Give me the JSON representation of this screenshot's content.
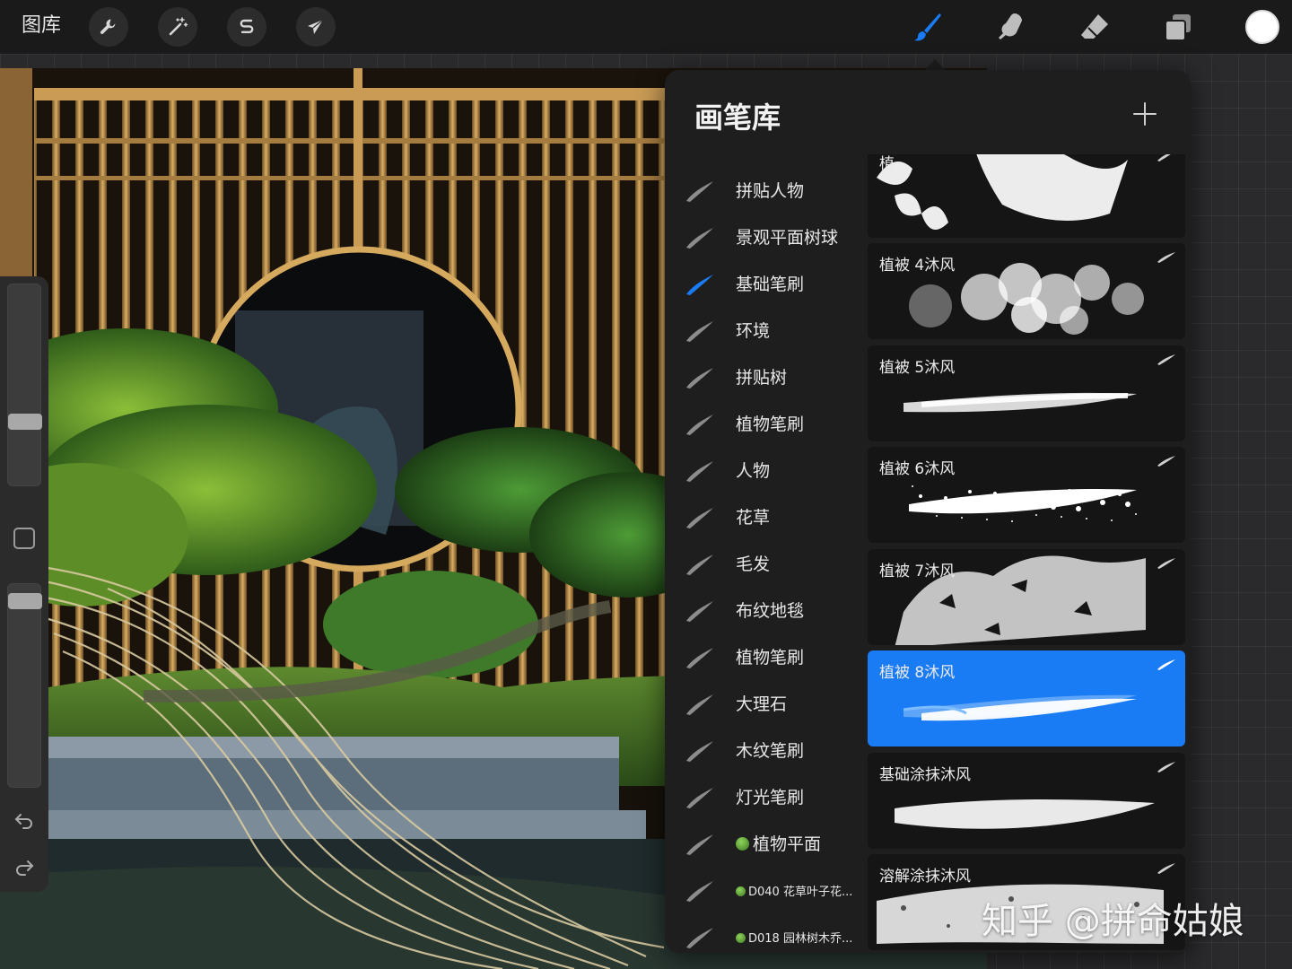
{
  "toolbar": {
    "gallery_label": "图库",
    "left_tools": [
      {
        "name": "actions",
        "icon": "wrench-icon"
      },
      {
        "name": "adjustments",
        "icon": "magic-wand-icon"
      },
      {
        "name": "selection",
        "icon": "selection-s-icon"
      },
      {
        "name": "transform",
        "icon": "arrow-cursor-icon"
      }
    ],
    "right_tools": [
      {
        "name": "brush",
        "icon": "brush-icon",
        "active": true
      },
      {
        "name": "smudge",
        "icon": "smudge-finger-icon"
      },
      {
        "name": "eraser",
        "icon": "eraser-icon"
      },
      {
        "name": "layers",
        "icon": "layers-icon"
      }
    ],
    "current_color": "#ffffff",
    "active_color": "#1a7cf5"
  },
  "sidebar": {
    "brush_size_level": 0.3,
    "opacity_level": 0.95
  },
  "brush_library": {
    "title": "画笔库",
    "add_icon": "plus-icon",
    "sets": [
      {
        "label": "拼贴人物"
      },
      {
        "label": "景观平面树球"
      },
      {
        "label": "基础笔刷",
        "selected": true
      },
      {
        "label": "环境"
      },
      {
        "label": "拼贴树"
      },
      {
        "label": "植物笔刷"
      },
      {
        "label": "人物"
      },
      {
        "label": "花草"
      },
      {
        "label": "毛发"
      },
      {
        "label": "布纹地毯"
      },
      {
        "label": "植物笔刷"
      },
      {
        "label": "大理石"
      },
      {
        "label": "木纹笔刷"
      },
      {
        "label": "灯光笔刷"
      },
      {
        "label": "植物平面",
        "tree": true
      },
      {
        "label": "D040 花草叶子花...",
        "tree": true,
        "small": true
      },
      {
        "label": "D018 园林树木乔...",
        "tree": true,
        "small": true
      }
    ],
    "brushes": [
      {
        "name": "植",
        "style": "leaves"
      },
      {
        "name": "植被 4沐风",
        "style": "clouds"
      },
      {
        "name": "植被 5沐风",
        "style": "soft"
      },
      {
        "name": "植被 6沐风",
        "style": "spatter"
      },
      {
        "name": "植被 7沐风",
        "style": "foliage"
      },
      {
        "name": "植被 8沐风",
        "style": "soft-blue",
        "selected": true
      },
      {
        "name": "基础涂抹沐风",
        "style": "smear"
      },
      {
        "name": "溶解涂抹沐风",
        "style": "dissolve"
      }
    ]
  },
  "watermark": "知乎 @拼命姑娘"
}
